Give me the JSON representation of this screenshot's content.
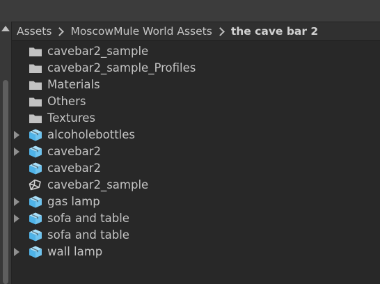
{
  "breadcrumb": {
    "items": [
      "Assets",
      "MoscowMule World Assets",
      "the cave bar 2"
    ]
  },
  "files": [
    {
      "label": "cavebar2_sample",
      "icon": "folder-icon",
      "expandable": false
    },
    {
      "label": "cavebar2_sample_Profiles",
      "icon": "folder-icon",
      "expandable": false
    },
    {
      "label": "Materials",
      "icon": "folder-icon",
      "expandable": false
    },
    {
      "label": "Others",
      "icon": "folder-icon",
      "expandable": false
    },
    {
      "label": "Textures",
      "icon": "folder-icon",
      "expandable": false
    },
    {
      "label": "alcoholebottles",
      "icon": "prefab-icon",
      "expandable": true
    },
    {
      "label": "cavebar2",
      "icon": "prefab-icon",
      "expandable": true
    },
    {
      "label": "cavebar2",
      "icon": "prefab-icon",
      "expandable": false
    },
    {
      "label": "cavebar2_sample",
      "icon": "unity-scene-icon",
      "expandable": false
    },
    {
      "label": "gas lamp",
      "icon": "prefab-icon",
      "expandable": true
    },
    {
      "label": "sofa and table",
      "icon": "prefab-icon",
      "expandable": true
    },
    {
      "label": "sofa and table",
      "icon": "prefab-icon",
      "expandable": false
    },
    {
      "label": "wall lamp",
      "icon": "prefab-icon",
      "expandable": true
    }
  ],
  "colors": {
    "background": "#282828",
    "folder": "#c2c2c2",
    "prefab": "#6fc3ee",
    "text": "#c4c4c4"
  }
}
